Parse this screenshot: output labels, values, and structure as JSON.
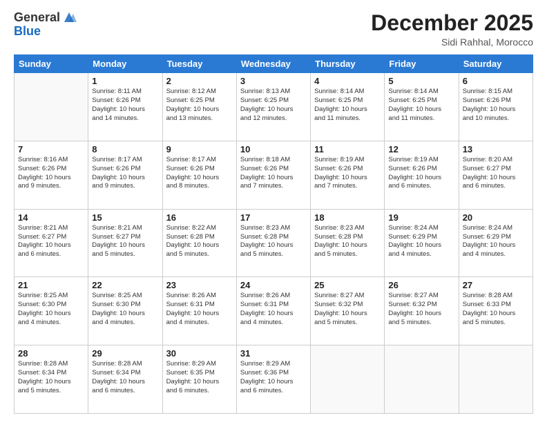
{
  "logo": {
    "general": "General",
    "blue": "Blue"
  },
  "title": "December 2025",
  "location": "Sidi Rahhal, Morocco",
  "days_header": [
    "Sunday",
    "Monday",
    "Tuesday",
    "Wednesday",
    "Thursday",
    "Friday",
    "Saturday"
  ],
  "weeks": [
    [
      {
        "day": "",
        "info": ""
      },
      {
        "day": "1",
        "info": "Sunrise: 8:11 AM\nSunset: 6:26 PM\nDaylight: 10 hours\nand 14 minutes."
      },
      {
        "day": "2",
        "info": "Sunrise: 8:12 AM\nSunset: 6:25 PM\nDaylight: 10 hours\nand 13 minutes."
      },
      {
        "day": "3",
        "info": "Sunrise: 8:13 AM\nSunset: 6:25 PM\nDaylight: 10 hours\nand 12 minutes."
      },
      {
        "day": "4",
        "info": "Sunrise: 8:14 AM\nSunset: 6:25 PM\nDaylight: 10 hours\nand 11 minutes."
      },
      {
        "day": "5",
        "info": "Sunrise: 8:14 AM\nSunset: 6:25 PM\nDaylight: 10 hours\nand 11 minutes."
      },
      {
        "day": "6",
        "info": "Sunrise: 8:15 AM\nSunset: 6:26 PM\nDaylight: 10 hours\nand 10 minutes."
      }
    ],
    [
      {
        "day": "7",
        "info": "Sunrise: 8:16 AM\nSunset: 6:26 PM\nDaylight: 10 hours\nand 9 minutes."
      },
      {
        "day": "8",
        "info": "Sunrise: 8:17 AM\nSunset: 6:26 PM\nDaylight: 10 hours\nand 9 minutes."
      },
      {
        "day": "9",
        "info": "Sunrise: 8:17 AM\nSunset: 6:26 PM\nDaylight: 10 hours\nand 8 minutes."
      },
      {
        "day": "10",
        "info": "Sunrise: 8:18 AM\nSunset: 6:26 PM\nDaylight: 10 hours\nand 7 minutes."
      },
      {
        "day": "11",
        "info": "Sunrise: 8:19 AM\nSunset: 6:26 PM\nDaylight: 10 hours\nand 7 minutes."
      },
      {
        "day": "12",
        "info": "Sunrise: 8:19 AM\nSunset: 6:26 PM\nDaylight: 10 hours\nand 6 minutes."
      },
      {
        "day": "13",
        "info": "Sunrise: 8:20 AM\nSunset: 6:27 PM\nDaylight: 10 hours\nand 6 minutes."
      }
    ],
    [
      {
        "day": "14",
        "info": "Sunrise: 8:21 AM\nSunset: 6:27 PM\nDaylight: 10 hours\nand 6 minutes."
      },
      {
        "day": "15",
        "info": "Sunrise: 8:21 AM\nSunset: 6:27 PM\nDaylight: 10 hours\nand 5 minutes."
      },
      {
        "day": "16",
        "info": "Sunrise: 8:22 AM\nSunset: 6:28 PM\nDaylight: 10 hours\nand 5 minutes."
      },
      {
        "day": "17",
        "info": "Sunrise: 8:23 AM\nSunset: 6:28 PM\nDaylight: 10 hours\nand 5 minutes."
      },
      {
        "day": "18",
        "info": "Sunrise: 8:23 AM\nSunset: 6:28 PM\nDaylight: 10 hours\nand 5 minutes."
      },
      {
        "day": "19",
        "info": "Sunrise: 8:24 AM\nSunset: 6:29 PM\nDaylight: 10 hours\nand 4 minutes."
      },
      {
        "day": "20",
        "info": "Sunrise: 8:24 AM\nSunset: 6:29 PM\nDaylight: 10 hours\nand 4 minutes."
      }
    ],
    [
      {
        "day": "21",
        "info": "Sunrise: 8:25 AM\nSunset: 6:30 PM\nDaylight: 10 hours\nand 4 minutes."
      },
      {
        "day": "22",
        "info": "Sunrise: 8:25 AM\nSunset: 6:30 PM\nDaylight: 10 hours\nand 4 minutes."
      },
      {
        "day": "23",
        "info": "Sunrise: 8:26 AM\nSunset: 6:31 PM\nDaylight: 10 hours\nand 4 minutes."
      },
      {
        "day": "24",
        "info": "Sunrise: 8:26 AM\nSunset: 6:31 PM\nDaylight: 10 hours\nand 4 minutes."
      },
      {
        "day": "25",
        "info": "Sunrise: 8:27 AM\nSunset: 6:32 PM\nDaylight: 10 hours\nand 5 minutes."
      },
      {
        "day": "26",
        "info": "Sunrise: 8:27 AM\nSunset: 6:32 PM\nDaylight: 10 hours\nand 5 minutes."
      },
      {
        "day": "27",
        "info": "Sunrise: 8:28 AM\nSunset: 6:33 PM\nDaylight: 10 hours\nand 5 minutes."
      }
    ],
    [
      {
        "day": "28",
        "info": "Sunrise: 8:28 AM\nSunset: 6:34 PM\nDaylight: 10 hours\nand 5 minutes."
      },
      {
        "day": "29",
        "info": "Sunrise: 8:28 AM\nSunset: 6:34 PM\nDaylight: 10 hours\nand 6 minutes."
      },
      {
        "day": "30",
        "info": "Sunrise: 8:29 AM\nSunset: 6:35 PM\nDaylight: 10 hours\nand 6 minutes."
      },
      {
        "day": "31",
        "info": "Sunrise: 8:29 AM\nSunset: 6:36 PM\nDaylight: 10 hours\nand 6 minutes."
      },
      {
        "day": "",
        "info": ""
      },
      {
        "day": "",
        "info": ""
      },
      {
        "day": "",
        "info": ""
      }
    ]
  ]
}
